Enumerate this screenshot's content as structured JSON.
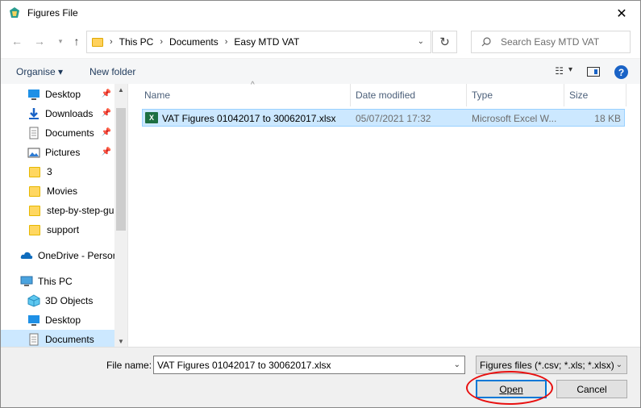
{
  "window": {
    "title": "Figures File",
    "close_glyph": "✕"
  },
  "address": {
    "crumbs": [
      "This PC",
      "Documents",
      "Easy MTD VAT"
    ]
  },
  "search": {
    "placeholder": "Search Easy MTD VAT"
  },
  "toolbar": {
    "organise": "Organise ▾",
    "new_folder": "New folder",
    "help": "?"
  },
  "nav": {
    "items": [
      {
        "label": "Desktop",
        "icon": "desktop-icon",
        "pinned": true
      },
      {
        "label": "Downloads",
        "icon": "downloads-icon",
        "pinned": true
      },
      {
        "label": "Documents",
        "icon": "documents-icon",
        "pinned": true
      },
      {
        "label": "Pictures",
        "icon": "pictures-icon",
        "pinned": true
      },
      {
        "label": "3",
        "icon": "folder-icon"
      },
      {
        "label": "Movies",
        "icon": "folder-icon"
      },
      {
        "label": "step-by-step-gu",
        "icon": "folder-icon"
      },
      {
        "label": "support",
        "icon": "folder-icon"
      },
      {
        "label": "OneDrive - Persor",
        "icon": "onedrive-icon"
      },
      {
        "label": "This PC",
        "icon": "this-pc-icon"
      },
      {
        "label": "3D Objects",
        "icon": "3d-objects-icon"
      },
      {
        "label": "Desktop",
        "icon": "desktop-icon"
      },
      {
        "label": "Documents",
        "icon": "documents-icon",
        "selected": true
      }
    ]
  },
  "columns": {
    "name": "Name",
    "date": "Date modified",
    "type": "Type",
    "size": "Size"
  },
  "files": [
    {
      "name": "VAT Figures 01042017 to 30062017.xlsx",
      "date": "05/07/2021 17:32",
      "type": "Microsoft Excel W...",
      "size": "18 KB"
    }
  ],
  "bottom": {
    "file_name_label": "File name:",
    "file_name_value": "VAT Figures 01042017 to 30062017.xlsx",
    "filter": "Figures files (*.csv; *.xls; *.xlsx)",
    "open_label": "Open",
    "cancel_label": "Cancel"
  },
  "colors": {
    "accent": "#0078d7",
    "selection": "#cce8ff",
    "annotation": "#e81010"
  }
}
